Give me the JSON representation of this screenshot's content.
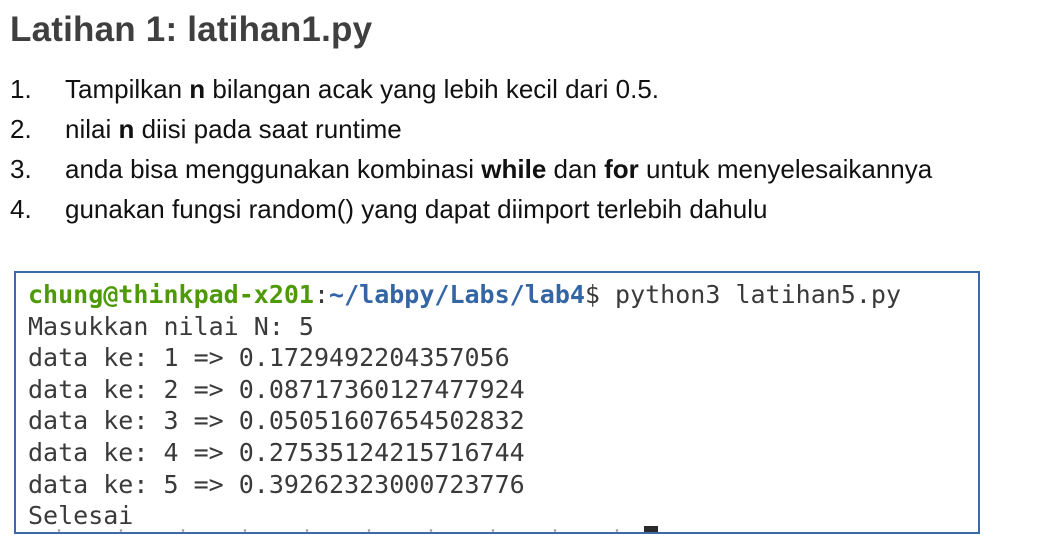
{
  "title": "Latihan 1: latihan1.py",
  "steps": [
    {
      "num": "1.",
      "parts": [
        {
          "text": "Tampilkan ",
          "bold": false
        },
        {
          "text": "n",
          "bold": true
        },
        {
          "text": " bilangan acak yang lebih kecil dari 0.5.",
          "bold": false
        }
      ]
    },
    {
      "num": "2.",
      "parts": [
        {
          "text": "nilai ",
          "bold": false
        },
        {
          "text": "n",
          "bold": true
        },
        {
          "text": " diisi pada saat runtime",
          "bold": false
        }
      ]
    },
    {
      "num": "3.",
      "parts": [
        {
          "text": "anda bisa menggunakan kombinasi ",
          "bold": false
        },
        {
          "text": "while",
          "bold": true
        },
        {
          "text": " dan ",
          "bold": false
        },
        {
          "text": "for",
          "bold": true
        },
        {
          "text": " untuk menyelesaikannya",
          "bold": false
        }
      ]
    },
    {
      "num": "4.",
      "parts": [
        {
          "text": "gunakan fungsi random() yang dapat diimport terlebih dahulu",
          "bold": false
        }
      ]
    }
  ],
  "terminal": {
    "prompt_user": "chung@thinkpad-x201",
    "prompt_sep": ":",
    "prompt_path": "~/labpy/Labs/lab4",
    "prompt_symbol": "$ ",
    "command": "python3 latihan5.py",
    "output": [
      "Masukkan nilai N: 5",
      "data ke: 1 => 0.1729492204357056",
      "data ke: 2 => 0.08717360127477924",
      "data ke: 3 => 0.05051607654502832",
      "data ke: 4 => 0.27535124215716744",
      "data ke: 5 => 0.39262323000723776",
      "Selesai"
    ]
  }
}
